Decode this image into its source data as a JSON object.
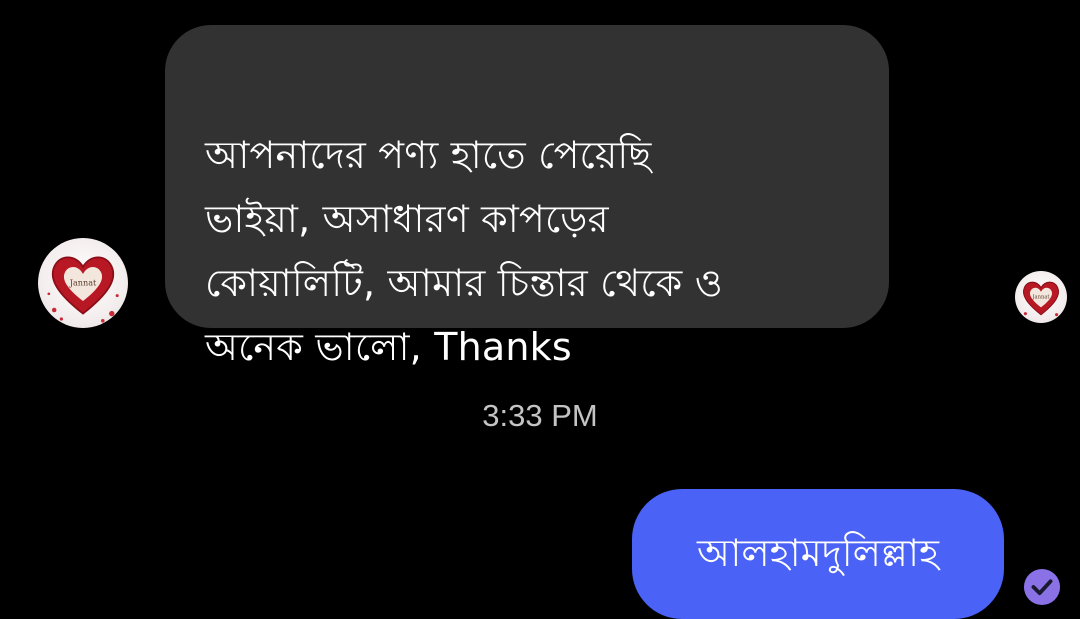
{
  "conversation": {
    "incoming": {
      "text": "আপনাদের পণ্য হাতে পেয়েছি\nভাইয়া, অসাধারণ কাপড়ের\nকোয়ালিটি, আমার চিন্তার থেকে ও\nঅনেক ভালো, Thanks",
      "avatar_label": "Jannat"
    },
    "timestamp": "3:33 PM",
    "outgoing": {
      "text": "আলহামদুলিল্লাহ"
    },
    "read_avatar_label": "Jannat"
  },
  "colors": {
    "background": "#000000",
    "incoming_bubble": "#323232",
    "outgoing_bubble": "#4a62f6",
    "timestamp": "#c4c4c4",
    "heart": "#b81824",
    "receipt": "#8a72e6"
  },
  "icons": {
    "sender_avatar": "heart-avatar-icon",
    "read_receipt": "check-circle-icon"
  }
}
